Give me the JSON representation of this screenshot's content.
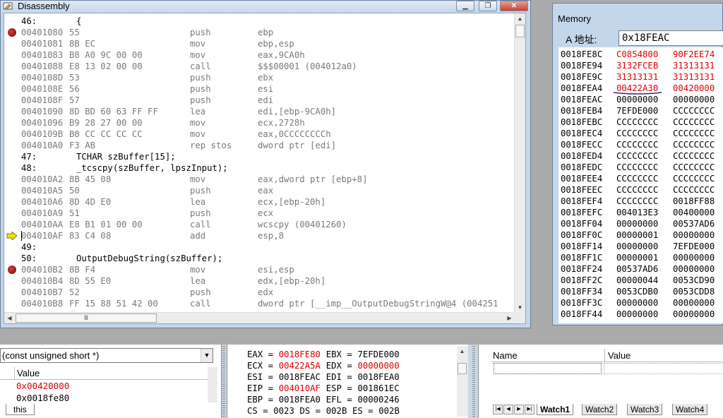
{
  "disassembly": {
    "title": "Disassembly",
    "rows": [
      {
        "kind": "src",
        "line": "46:",
        "text": "{"
      },
      {
        "kind": "asm",
        "bp": true,
        "addr": "00401080",
        "bytes": "55",
        "mn": "push",
        "op": "ebp"
      },
      {
        "kind": "asm",
        "addr": "00401081",
        "bytes": "8B EC",
        "mn": "mov",
        "op": "ebp,esp"
      },
      {
        "kind": "asm",
        "addr": "00401083",
        "bytes": "B8 A0 9C 00 00",
        "mn": "mov",
        "op": "eax,9CA0h"
      },
      {
        "kind": "asm",
        "addr": "00401088",
        "bytes": "E8 13 02 00 00",
        "mn": "call",
        "op": "$$$00001 (004012a0)"
      },
      {
        "kind": "asm",
        "addr": "0040108D",
        "bytes": "53",
        "mn": "push",
        "op": "ebx"
      },
      {
        "kind": "asm",
        "addr": "0040108E",
        "bytes": "56",
        "mn": "push",
        "op": "esi"
      },
      {
        "kind": "asm",
        "addr": "0040108F",
        "bytes": "57",
        "mn": "push",
        "op": "edi"
      },
      {
        "kind": "asm",
        "addr": "00401090",
        "bytes": "8D BD 60 63 FF FF",
        "mn": "lea",
        "op": "edi,[ebp-9CA0h]"
      },
      {
        "kind": "asm",
        "addr": "00401096",
        "bytes": "B9 28 27 00 00",
        "mn": "mov",
        "op": "ecx,2728h"
      },
      {
        "kind": "asm",
        "addr": "0040109B",
        "bytes": "B8 CC CC CC CC",
        "mn": "mov",
        "op": "eax,0CCCCCCCCh"
      },
      {
        "kind": "asm",
        "addr": "004010A0",
        "bytes": "F3 AB",
        "mn": "rep stos",
        "op": "dword ptr [edi]"
      },
      {
        "kind": "src",
        "line": "47:",
        "text": "TCHAR szBuffer[15];"
      },
      {
        "kind": "src",
        "line": "48:",
        "text": "_tcscpy(szBuffer, lpszInput);"
      },
      {
        "kind": "asm",
        "addr": "004010A2",
        "bytes": "8B 45 08",
        "mn": "mov",
        "op": "eax,dword ptr [ebp+8]"
      },
      {
        "kind": "asm",
        "addr": "004010A5",
        "bytes": "50",
        "mn": "push",
        "op": "eax"
      },
      {
        "kind": "asm",
        "addr": "004010A6",
        "bytes": "8D 4D E0",
        "mn": "lea",
        "op": "ecx,[ebp-20h]"
      },
      {
        "kind": "asm",
        "addr": "004010A9",
        "bytes": "51",
        "mn": "push",
        "op": "ecx"
      },
      {
        "kind": "asm",
        "addr": "004010AA",
        "bytes": "E8 B1 01 00 00",
        "mn": "call",
        "op": "wcscpy (00401260)"
      },
      {
        "kind": "asm",
        "ip": true,
        "addr": "004010AF",
        "bytes": "83 C4 08",
        "mn": "add",
        "op": "esp,8"
      },
      {
        "kind": "src",
        "line": "49:",
        "text": ""
      },
      {
        "kind": "src",
        "line": "50:",
        "text": "OutputDebugString(szBuffer);"
      },
      {
        "kind": "asm",
        "bp": true,
        "addr": "004010B2",
        "bytes": "8B F4",
        "mn": "mov",
        "op": "esi,esp"
      },
      {
        "kind": "asm",
        "addr": "004010B4",
        "bytes": "8D 55 E0",
        "mn": "lea",
        "op": "edx,[ebp-20h]"
      },
      {
        "kind": "asm",
        "addr": "004010B7",
        "bytes": "52",
        "mn": "push",
        "op": "edx"
      },
      {
        "kind": "asm",
        "addr": "004010B8",
        "bytes": "FF 15 88 51 42 00",
        "mn": "call",
        "op": "dword ptr [__imp__OutputDebugStringW@4 (004251"
      }
    ]
  },
  "memory": {
    "title": "Memory",
    "address_label": "A 地址:",
    "address_value": "0x18FEAC",
    "rows": [
      {
        "addr": "0018FE8C",
        "v1": "C0854800",
        "v2": "90F2EE74",
        "r1": true,
        "r2": true
      },
      {
        "addr": "0018FE94",
        "v1": "3132FCEB",
        "v2": "31313131",
        "r1": true,
        "r2": true
      },
      {
        "addr": "0018FE9C",
        "v1": "31313131",
        "v2": "31313131",
        "r1": true,
        "r2": true
      },
      {
        "addr": "0018FEA4",
        "v1": "00422A30",
        "v2": "00420000",
        "r1": true,
        "r2": true
      },
      {
        "addr": "0018FEAC",
        "v1": "00000000",
        "v2": "00000000"
      },
      {
        "addr": "0018FEB4",
        "v1": "7EFDE000",
        "v2": "CCCCCCCC"
      },
      {
        "addr": "0018FEBC",
        "v1": "CCCCCCCC",
        "v2": "CCCCCCCC"
      },
      {
        "addr": "0018FEC4",
        "v1": "CCCCCCCC",
        "v2": "CCCCCCCC"
      },
      {
        "addr": "0018FECC",
        "v1": "CCCCCCCC",
        "v2": "CCCCCCCC"
      },
      {
        "addr": "0018FED4",
        "v1": "CCCCCCCC",
        "v2": "CCCCCCCC"
      },
      {
        "addr": "0018FEDC",
        "v1": "CCCCCCCC",
        "v2": "CCCCCCCC"
      },
      {
        "addr": "0018FEE4",
        "v1": "CCCCCCCC",
        "v2": "CCCCCCCC"
      },
      {
        "addr": "0018FEEC",
        "v1": "CCCCCCCC",
        "v2": "CCCCCCCC"
      },
      {
        "addr": "0018FEF4",
        "v1": "CCCCCCCC",
        "v2": "0018FF88"
      },
      {
        "addr": "0018FEFC",
        "v1": "004013E3",
        "v2": "00400000"
      },
      {
        "addr": "0018FF04",
        "v1": "00000000",
        "v2": "00537AD6"
      },
      {
        "addr": "0018FF0C",
        "v1": "00000001",
        "v2": "00000000"
      },
      {
        "addr": "0018FF14",
        "v1": "00000000",
        "v2": "7EFDE000"
      },
      {
        "addr": "0018FF1C",
        "v1": "00000001",
        "v2": "00000000"
      },
      {
        "addr": "0018FF24",
        "v1": "00537AD6",
        "v2": "00000000"
      },
      {
        "addr": "0018FF2C",
        "v1": "00000044",
        "v2": "0053CD90"
      },
      {
        "addr": "0018FF34",
        "v1": "0053CDB0",
        "v2": "0053CDD8"
      },
      {
        "addr": "0018FF3C",
        "v1": "00000000",
        "v2": "00000000"
      },
      {
        "addr": "0018FF44",
        "v1": "00000000",
        "v2": "00000000"
      }
    ]
  },
  "variables": {
    "context": "(const unsigned short *)",
    "header_value": "Value",
    "rows": [
      {
        "value": "0x00420000",
        "red": true
      },
      {
        "value": "0x0018fe80",
        "red": false
      }
    ],
    "tab": "this"
  },
  "registers": {
    "rows": [
      [
        {
          "t": "EAX = "
        },
        {
          "t": "0018FE80",
          "red": true
        },
        {
          "t": " EBX = "
        },
        {
          "t": "7EFDE000"
        }
      ],
      [
        {
          "t": "ECX = "
        },
        {
          "t": "00422A5A",
          "red": true
        },
        {
          "t": " EDX = "
        },
        {
          "t": "00000000",
          "red": true
        }
      ],
      [
        {
          "t": "ESI = "
        },
        {
          "t": "0018FEAC"
        },
        {
          "t": " EDI = "
        },
        {
          "t": "0018FEA0"
        }
      ],
      [
        {
          "t": "EIP = "
        },
        {
          "t": "004010AF",
          "red": true
        },
        {
          "t": " ESP = "
        },
        {
          "t": "001861EC"
        }
      ],
      [
        {
          "t": "EBP = "
        },
        {
          "t": "0018FEA0"
        },
        {
          "t": " EFL = "
        },
        {
          "t": "00000246"
        }
      ],
      [
        {
          "t": "CS = "
        },
        {
          "t": "0023"
        },
        {
          "t": " DS = "
        },
        {
          "t": "002B"
        },
        {
          "t": " ES = "
        },
        {
          "t": "002B"
        }
      ]
    ]
  },
  "watch": {
    "header_name": "Name",
    "header_value": "Value",
    "tabs": [
      "Watch1",
      "Watch2",
      "Watch3",
      "Watch4"
    ],
    "active_tab": 0
  },
  "colors": {
    "red": "#e00000",
    "breakpoint": "#9a0000",
    "ip_arrow": "#f2e200"
  }
}
